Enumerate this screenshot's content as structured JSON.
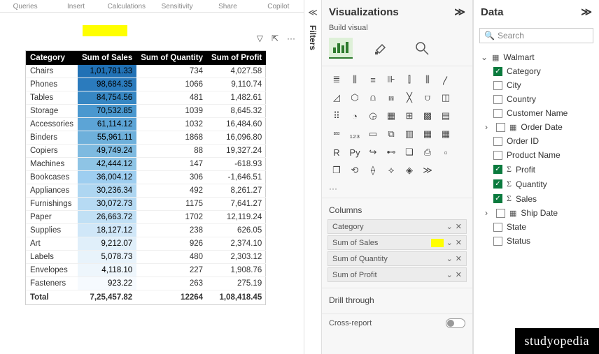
{
  "ribbon": [
    "Queries",
    "Insert",
    "Calculations",
    "Sensitivity",
    "Share",
    "Copilot"
  ],
  "filters": {
    "label": "Filters"
  },
  "table": {
    "headers": [
      "Category",
      "Sum of Sales",
      "Sum of Quantity",
      "Sum of Profit"
    ],
    "rows": [
      {
        "cat": "Chairs",
        "sales": "1,01,781.33",
        "salesbg": "#2171b5",
        "qty": "734",
        "profit": "4,027.58"
      },
      {
        "cat": "Phones",
        "sales": "98,684.35",
        "salesbg": "#2b7bbd",
        "qty": "1066",
        "profit": "9,110.74"
      },
      {
        "cat": "Tables",
        "sales": "84,754.56",
        "salesbg": "#3787c3",
        "qty": "481",
        "profit": "1,482.61"
      },
      {
        "cat": "Storage",
        "sales": "70,532.85",
        "salesbg": "#4a98cf",
        "qty": "1039",
        "profit": "8,645.32"
      },
      {
        "cat": "Accessories",
        "sales": "61,114.12",
        "salesbg": "#5ca4d6",
        "qty": "1032",
        "profit": "16,484.60"
      },
      {
        "cat": "Binders",
        "sales": "55,961.11",
        "salesbg": "#6eb0db",
        "qty": "1868",
        "profit": "16,096.80"
      },
      {
        "cat": "Copiers",
        "sales": "49,749.24",
        "salesbg": "#7ebae0",
        "qty": "88",
        "profit": "19,327.24"
      },
      {
        "cat": "Machines",
        "sales": "42,444.12",
        "salesbg": "#8ec4e5",
        "qty": "147",
        "profit": "-618.93"
      },
      {
        "cat": "Bookcases",
        "sales": "36,004.12",
        "salesbg": "#9ecef0",
        "qty": "306",
        "profit": "-1,646.51"
      },
      {
        "cat": "Appliances",
        "sales": "30,236.34",
        "salesbg": "#aed6f1",
        "qty": "492",
        "profit": "8,261.27"
      },
      {
        "cat": "Furnishings",
        "sales": "30,072.73",
        "salesbg": "#b6daf3",
        "qty": "1175",
        "profit": "7,641.27"
      },
      {
        "cat": "Paper",
        "sales": "26,663.72",
        "salesbg": "#c1e0f5",
        "qty": "1702",
        "profit": "12,119.24"
      },
      {
        "cat": "Supplies",
        "sales": "18,127.12",
        "salesbg": "#d0e7f8",
        "qty": "238",
        "profit": "626.05"
      },
      {
        "cat": "Art",
        "sales": "9,212.07",
        "salesbg": "#e0effa",
        "qty": "926",
        "profit": "2,374.10"
      },
      {
        "cat": "Labels",
        "sales": "5,078.73",
        "salesbg": "#e8f3fb",
        "qty": "480",
        "profit": "2,303.12"
      },
      {
        "cat": "Envelopes",
        "sales": "4,118.10",
        "salesbg": "#eef6fc",
        "qty": "227",
        "profit": "1,908.76"
      },
      {
        "cat": "Fasteners",
        "sales": "923.22",
        "salesbg": "#f6fafe",
        "qty": "263",
        "profit": "275.19"
      }
    ],
    "total": {
      "label": "Total",
      "sales": "7,25,457.82",
      "qty": "12264",
      "profit": "1,08,418.45"
    },
    "tools": {
      "filter": "▽",
      "focus": "⇱",
      "more": "···"
    }
  },
  "vis": {
    "title": "Visualizations",
    "sub": "Build visual",
    "columns_label": "Columns",
    "wells": [
      {
        "label": "Category",
        "highlight": false
      },
      {
        "label": "Sum of Sales",
        "highlight": true
      },
      {
        "label": "Sum of Quantity",
        "highlight": false
      },
      {
        "label": "Sum of Profit",
        "highlight": false
      }
    ],
    "drill_label": "Drill through",
    "cross_label": "Cross-report",
    "icons": [
      "stacked-bar",
      "stacked-column",
      "clustered-bar",
      "clustered-column",
      "100-bar",
      "100-column",
      "line",
      "area",
      "stacked-area",
      "line-stacked",
      "line-clustered",
      "ribbon",
      "waterfall",
      "funnel",
      "scatter",
      "pie",
      "donut",
      "treemap",
      "map",
      "filled-map",
      "azure-map",
      "gauge",
      "card",
      "multi-card",
      "kpi",
      "slicer",
      "table",
      "matrix",
      "r-visual",
      "py-visual",
      "key-infl",
      "decomp",
      "qna",
      "narrative",
      "paginated",
      "power-apps",
      "power-automate",
      "goals",
      "get-visuals",
      "more1",
      "more2"
    ],
    "glyphs": [
      "≣",
      "⫼",
      "≡",
      "⊪",
      "⫿",
      "⫼",
      "〳",
      "◿",
      "⬡",
      "⩍",
      "⩎",
      "╳",
      "⩌",
      "◫",
      "⠿",
      "◔",
      "◶",
      "▦",
      "⊞",
      "▩",
      "▤",
      "⮹",
      "₁₂₃",
      "▭",
      "⧉",
      "▥",
      "▦",
      "▦",
      "R",
      "Py",
      "↪",
      "⊷",
      "❏",
      "⎙",
      "▫",
      "❐",
      "⟲",
      "⟠",
      "⟡",
      "◈",
      "≫"
    ]
  },
  "data": {
    "title": "Data",
    "search_ph": "Search",
    "root": "Walmart",
    "fields": [
      {
        "name": "Category",
        "checked": true,
        "sigma": false,
        "date": false
      },
      {
        "name": "City",
        "checked": false,
        "sigma": false,
        "date": false
      },
      {
        "name": "Country",
        "checked": false,
        "sigma": false,
        "date": false
      },
      {
        "name": "Customer Name",
        "checked": false,
        "sigma": false,
        "date": false
      },
      {
        "name": "Order Date",
        "checked": false,
        "sigma": false,
        "date": true
      },
      {
        "name": "Order ID",
        "checked": false,
        "sigma": false,
        "date": false
      },
      {
        "name": "Product Name",
        "checked": false,
        "sigma": false,
        "date": false
      },
      {
        "name": "Profit",
        "checked": true,
        "sigma": true,
        "date": false
      },
      {
        "name": "Quantity",
        "checked": true,
        "sigma": true,
        "date": false
      },
      {
        "name": "Sales",
        "checked": true,
        "sigma": true,
        "date": false
      },
      {
        "name": "Ship Date",
        "checked": false,
        "sigma": false,
        "date": true
      },
      {
        "name": "State",
        "checked": false,
        "sigma": false,
        "date": false
      },
      {
        "name": "Status",
        "checked": false,
        "sigma": false,
        "date": false
      }
    ]
  },
  "brand": "studyopedia",
  "chart_data": {
    "type": "table",
    "title": "",
    "columns": [
      "Category",
      "Sum of Sales",
      "Sum of Quantity",
      "Sum of Profit"
    ],
    "rows": [
      [
        "Chairs",
        101781.33,
        734,
        4027.58
      ],
      [
        "Phones",
        98684.35,
        1066,
        9110.74
      ],
      [
        "Tables",
        84754.56,
        481,
        1482.61
      ],
      [
        "Storage",
        70532.85,
        1039,
        8645.32
      ],
      [
        "Accessories",
        61114.12,
        1032,
        16484.6
      ],
      [
        "Binders",
        55961.11,
        1868,
        16096.8
      ],
      [
        "Copiers",
        49749.24,
        88,
        19327.24
      ],
      [
        "Machines",
        42444.12,
        147,
        -618.93
      ],
      [
        "Bookcases",
        36004.12,
        306,
        -1646.51
      ],
      [
        "Appliances",
        30236.34,
        492,
        8261.27
      ],
      [
        "Furnishings",
        30072.73,
        1175,
        7641.27
      ],
      [
        "Paper",
        26663.72,
        1702,
        12119.24
      ],
      [
        "Supplies",
        18127.12,
        238,
        626.05
      ],
      [
        "Art",
        9212.07,
        926,
        2374.1
      ],
      [
        "Labels",
        5078.73,
        480,
        2303.12
      ],
      [
        "Envelopes",
        4118.1,
        227,
        1908.76
      ],
      [
        "Fasteners",
        923.22,
        263,
        275.19
      ]
    ],
    "totals": [
      "Total",
      725457.82,
      12264,
      108418.45
    ]
  }
}
